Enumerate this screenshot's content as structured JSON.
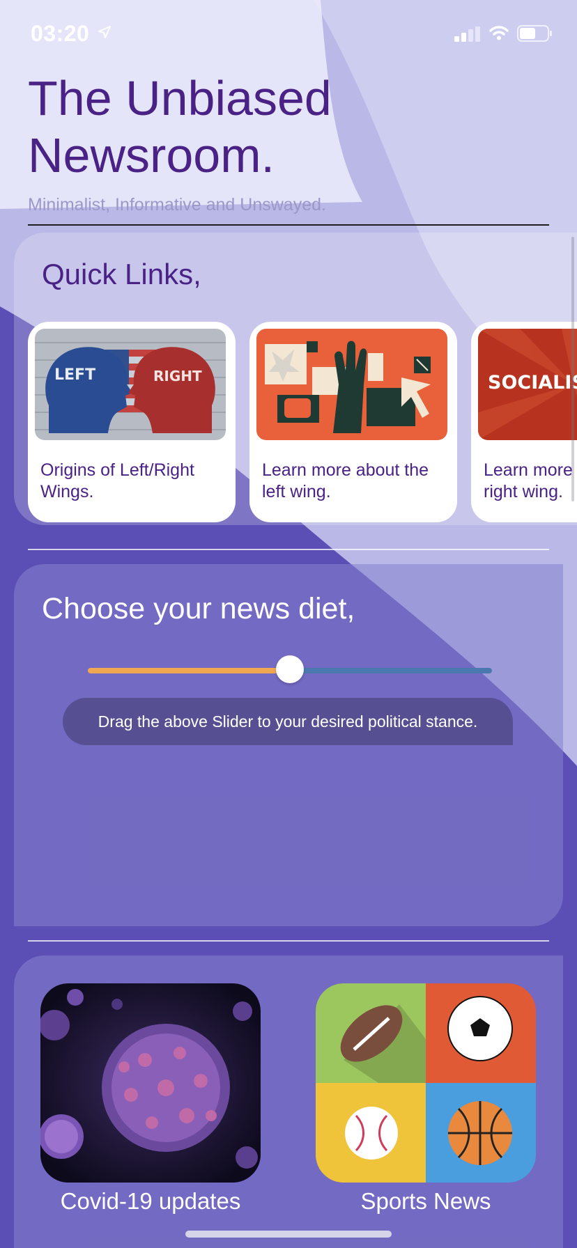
{
  "status_bar": {
    "time": "03:20"
  },
  "header": {
    "title": "The Unbiased Newsroom.",
    "subtitle": "Minimalist, Informative and Unswayed."
  },
  "quick_links": {
    "title": "Quick Links,",
    "cards": [
      {
        "label": "Origins of Left/Right Wings.",
        "image_text_left": "LEFT",
        "image_text_right": "RIGHT"
      },
      {
        "label": "Learn more about the left wing."
      },
      {
        "label": "Learn more about the right wing.",
        "image_text": "SOCIALIS"
      }
    ]
  },
  "news_diet": {
    "title": "Choose your news diet,",
    "slider_value_fraction": 0.5,
    "hint": "Drag the above Slider to your desired political stance."
  },
  "tiles": [
    {
      "label": "Covid-19 updates"
    },
    {
      "label": "Sports News"
    }
  ],
  "colors": {
    "accent_purple": "#4a2185",
    "slider_left": "#f0a852",
    "slider_right": "#4c78b0"
  },
  "icons": [
    "location-arrow-icon",
    "signal-icon",
    "wifi-icon",
    "battery-icon"
  ]
}
